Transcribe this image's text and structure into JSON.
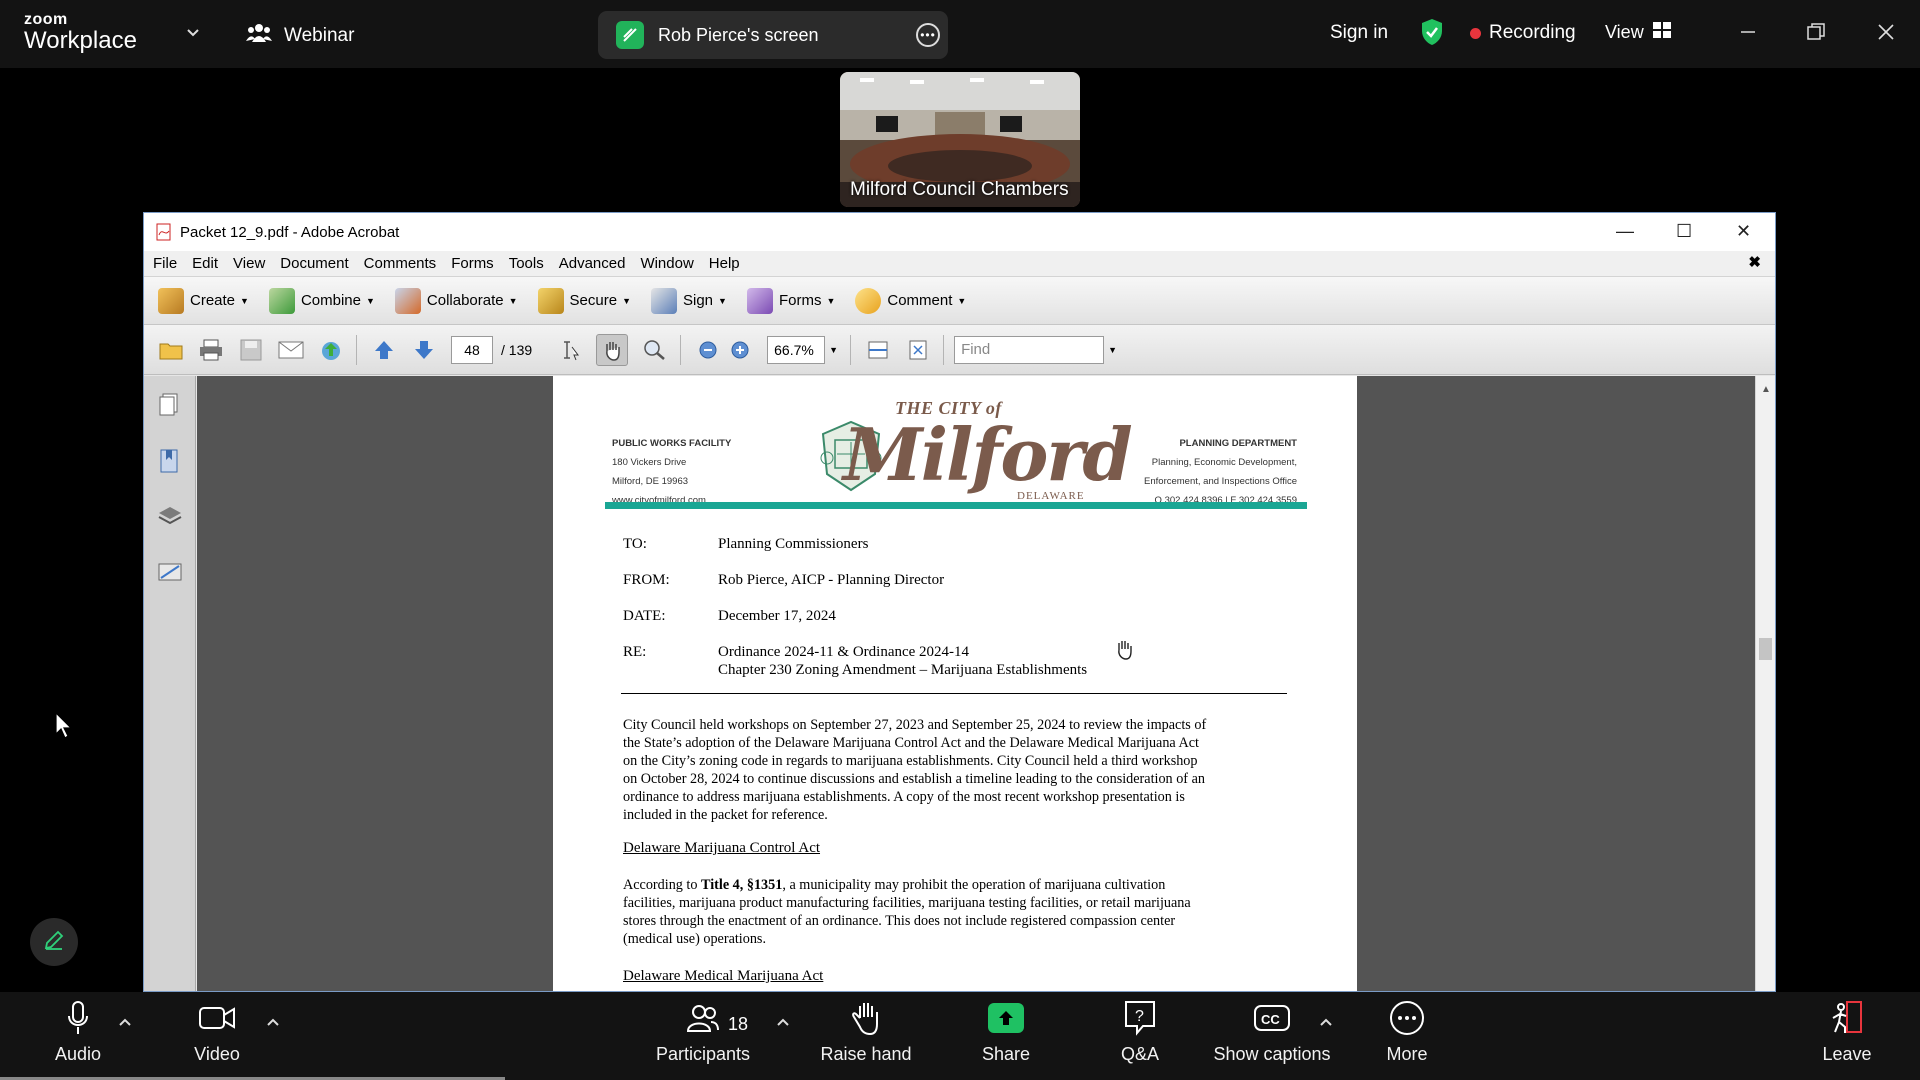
{
  "zoom": {
    "logo_line1": "zoom",
    "logo_line2": "Workplace",
    "webinar_label": "Webinar",
    "screen_share_label": "Rob Pierce's screen",
    "sign_in": "Sign in",
    "recording": "Recording",
    "view": "View",
    "video_tile_label": "Milford Council Chambers",
    "bottom": {
      "audio": "Audio",
      "video": "Video",
      "participants": "Participants",
      "participants_count": "18",
      "raise_hand": "Raise hand",
      "share": "Share",
      "qa": "Q&A",
      "show_captions": "Show captions",
      "more": "More",
      "leave": "Leave"
    },
    "colors": {
      "share_green": "#1fc163",
      "recording_red": "#e8353d",
      "shield_green": "#21c15f"
    }
  },
  "acrobat": {
    "title": "Packet 12_9.pdf - Adobe Acrobat",
    "menu": [
      "File",
      "Edit",
      "View",
      "Document",
      "Comments",
      "Forms",
      "Tools",
      "Advanced",
      "Window",
      "Help"
    ],
    "toolbar": {
      "create": "Create",
      "combine": "Combine",
      "collaborate": "Collaborate",
      "secure": "Secure",
      "sign": "Sign",
      "forms": "Forms",
      "comment": "Comment"
    },
    "nav": {
      "page_current": "48",
      "page_total": "/ 139",
      "zoom": "66.7%",
      "find_placeholder": "Find"
    }
  },
  "document": {
    "letterhead_left": [
      "PUBLIC WORKS FACILITY",
      "180 Vickers Drive",
      "Milford, DE 19963",
      "www.cityofmilford.com"
    ],
    "letterhead_right": [
      "PLANNING DEPARTMENT",
      "Planning, Economic Development,",
      "Enforcement, and Inspections Office",
      "O 302.424.8396 | F 302.424.3559"
    ],
    "logo": {
      "the_city_of": "THE CITY of",
      "name": "Milford",
      "state": "DELAWARE"
    },
    "memo": {
      "to_label": "TO:",
      "to": "Planning Commissioners",
      "from_label": "FROM:",
      "from": "Rob Pierce, AICP - Planning Director",
      "date_label": "DATE:",
      "date": "December 17, 2024",
      "re_label": "RE:",
      "re_line1": "Ordinance 2024-11 & Ordinance 2024-14",
      "re_line2": "Chapter 230 Zoning Amendment – Marijuana Establishments"
    },
    "para1": [
      "City Council held workshops on September 27, 2023 and September 25, 2024 to review the impacts of",
      "the State’s adoption of the Delaware Marijuana Control Act and the Delaware Medical Marijuana Act",
      "on the City’s zoning code in regards to marijuana establishments.  City Council held a third workshop",
      "on October 28, 2024 to continue discussions and establish a timeline leading to the consideration of an",
      "ordinance to address marijuana establishments.  A copy of the most recent workshop presentation is",
      "included in the packet for reference."
    ],
    "heading1": "Delaware Marijuana Control Act",
    "para2_prefix": "According to ",
    "para2_bold": "Title 4, §1351",
    "para2_line1_rest": ", a municipality may prohibit the operation of marijuana cultivation",
    "para2_rest": [
      "facilities, marijuana product manufacturing facilities, marijuana testing facilities, or retail marijuana",
      "stores through the enactment of an ordinance.  This does not include registered compassion center",
      "(medical use) operations."
    ],
    "heading2": "Delaware Medical Marijuana Act"
  }
}
